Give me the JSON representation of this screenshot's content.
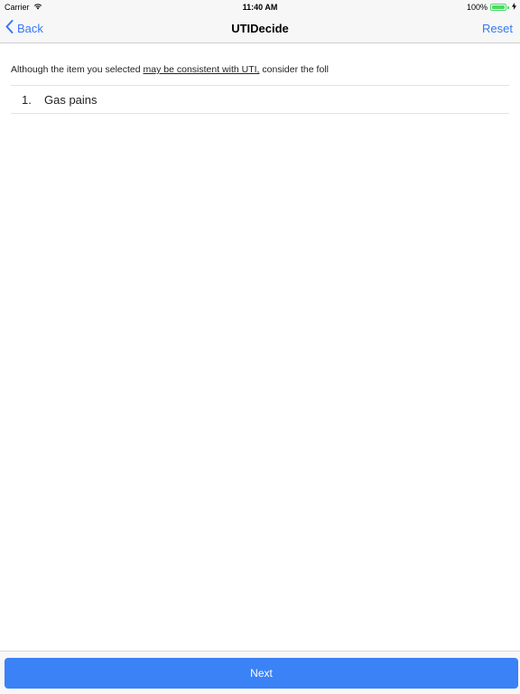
{
  "status_bar": {
    "carrier": "Carrier",
    "time": "11:40 AM",
    "battery_percent": "100%",
    "battery_level": 1.0
  },
  "nav": {
    "back_label": "Back",
    "title": "UTIDecide",
    "reset_label": "Reset"
  },
  "content": {
    "message_prefix": "Although the item you selected ",
    "message_link": "may be consistent with UTI,",
    "message_suffix": " consider the foll",
    "items": [
      {
        "number": "1.",
        "text": "Gas pains"
      }
    ]
  },
  "footer": {
    "next_label": "Next"
  },
  "colors": {
    "accent": "#3478f6",
    "button": "#3b82f6",
    "battery": "#4cd964"
  }
}
